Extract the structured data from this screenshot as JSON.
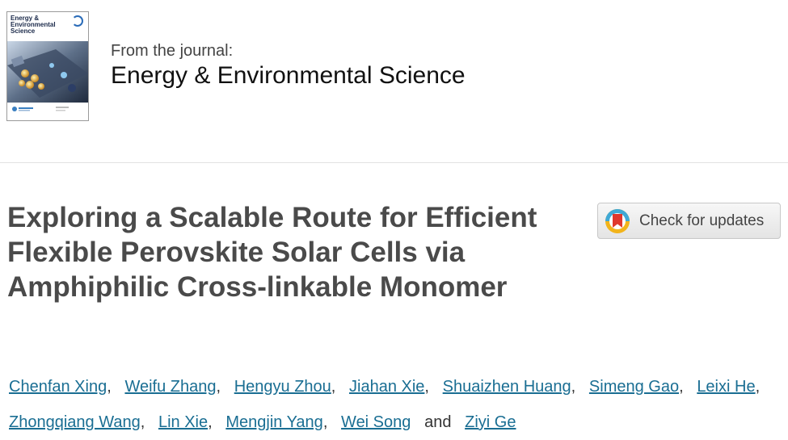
{
  "cover": {
    "title": "Energy & Environmental Science"
  },
  "journal": {
    "from_label": "From the journal:",
    "name": "Energy & Environmental Science"
  },
  "article": {
    "title": "Exploring a Scalable Route for Efficient Flexible Perovskite Solar Cells via Amphiphilic Cross-linkable Monomer"
  },
  "check_updates": {
    "label": "Check for updates",
    "icon": "crossmark-icon"
  },
  "authors": {
    "list": [
      "Chenfan Xing",
      "Weifu Zhang",
      "Hengyu Zhou",
      "Jiahan Xie",
      "Shuaizhen Huang",
      "Simeng Gao",
      "Leixi He",
      "Zhongqiang Wang",
      "Lin Xie",
      "Mengjin Yang",
      "Wei Song",
      "Ziyi Ge"
    ],
    "separator": ",",
    "and_word": "and"
  },
  "colors": {
    "link": "#1a6e93",
    "title": "#4a4a4a"
  }
}
